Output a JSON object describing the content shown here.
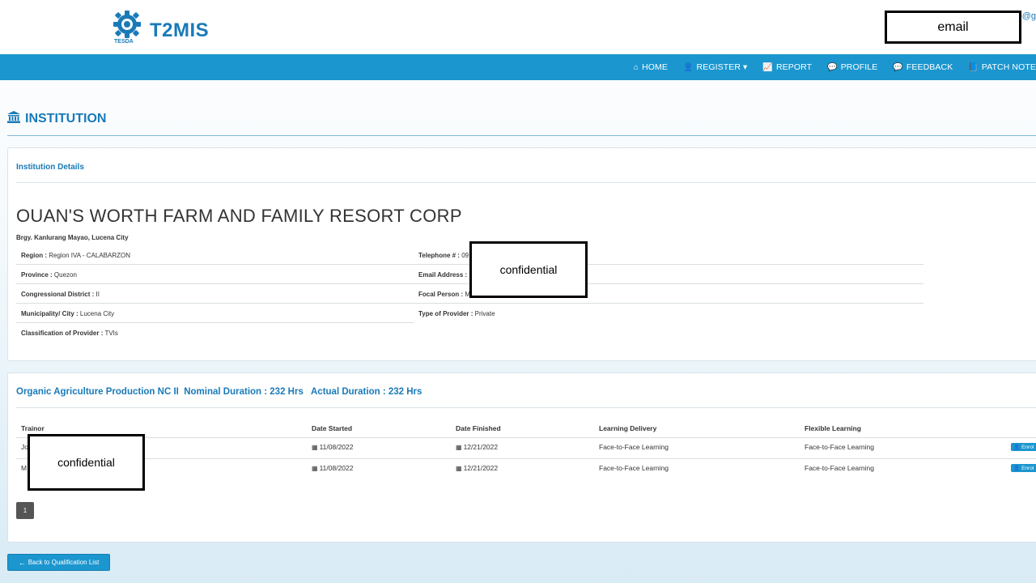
{
  "header": {
    "logo_label": "TESDA",
    "app_title": "T2MIS",
    "email_overflow": "p@g",
    "email_redaction": "email"
  },
  "nav": {
    "items": [
      {
        "icon": "home-icon",
        "glyph": "⌂",
        "label": "HOME"
      },
      {
        "icon": "add-user-icon",
        "glyph": "👤",
        "label": "REGISTER ▾"
      },
      {
        "icon": "chart-line-icon",
        "glyph": "📈",
        "label": "REPORT"
      },
      {
        "icon": "chat-icon",
        "glyph": "💬",
        "label": "PROFILE"
      },
      {
        "icon": "chat-icon",
        "glyph": "💬",
        "label": "FEEDBACK"
      },
      {
        "icon": "book-icon",
        "glyph": "📘",
        "label": "PATCH NOTE"
      }
    ]
  },
  "page": {
    "title": "INSTITUTION"
  },
  "institution": {
    "section_title": "Institution Details",
    "name": "OUAN'S WORTH FARM AND FAMILY RESORT CORP",
    "address": "Brgy. Kanlurang Mayao, Lucena City",
    "region_label": "Region :",
    "region_value": " Region IVA - CALABARZON",
    "province_label": "Province :",
    "province_value": " Quezon",
    "district_label": "Congressional District :",
    "district_value": " II",
    "municipality_label": "Municipality/ City :",
    "municipality_value": " Lucena City",
    "classification_label": "Classification of Provider :",
    "classification_value": " TVIs",
    "telephone_label": "Telephone # :",
    "telephone_value": " 09",
    "email_label": "Email Address :",
    "email_value": "",
    "focal_label": "Focal Person :",
    "focal_value": " M",
    "provider_type_label": "Type of Provider :",
    "provider_type_value": " Private",
    "redaction": "confidential"
  },
  "qualification": {
    "heading": "Organic Agriculture Production NC II  Nominal Duration : 232 Hrs   Actual Duration : 232 Hrs",
    "columns": [
      "Trainor",
      "Date Started",
      "Date Finished",
      "Learning Delivery",
      "Flexible Learning"
    ],
    "rows": [
      {
        "trainor": "Jo",
        "date_started": "11/08/2022",
        "date_finished": "12/21/2022",
        "learning_delivery": "Face-to-Face Learning",
        "flexible_learning": "Face-to-Face Learning",
        "action": "Enrol"
      },
      {
        "trainor": "M",
        "date_started": "11/08/2022",
        "date_finished": "12/21/2022",
        "learning_delivery": "Face-to-Face Learning",
        "flexible_learning": "Face-to-Face Learning",
        "action": "Enrol"
      }
    ],
    "redaction": "confidential",
    "current_page": "1"
  },
  "footer": {
    "back_label": "Back to Qualification List"
  },
  "colors": {
    "brand": "#1a7ab8",
    "navbar": "#1b96cf"
  }
}
